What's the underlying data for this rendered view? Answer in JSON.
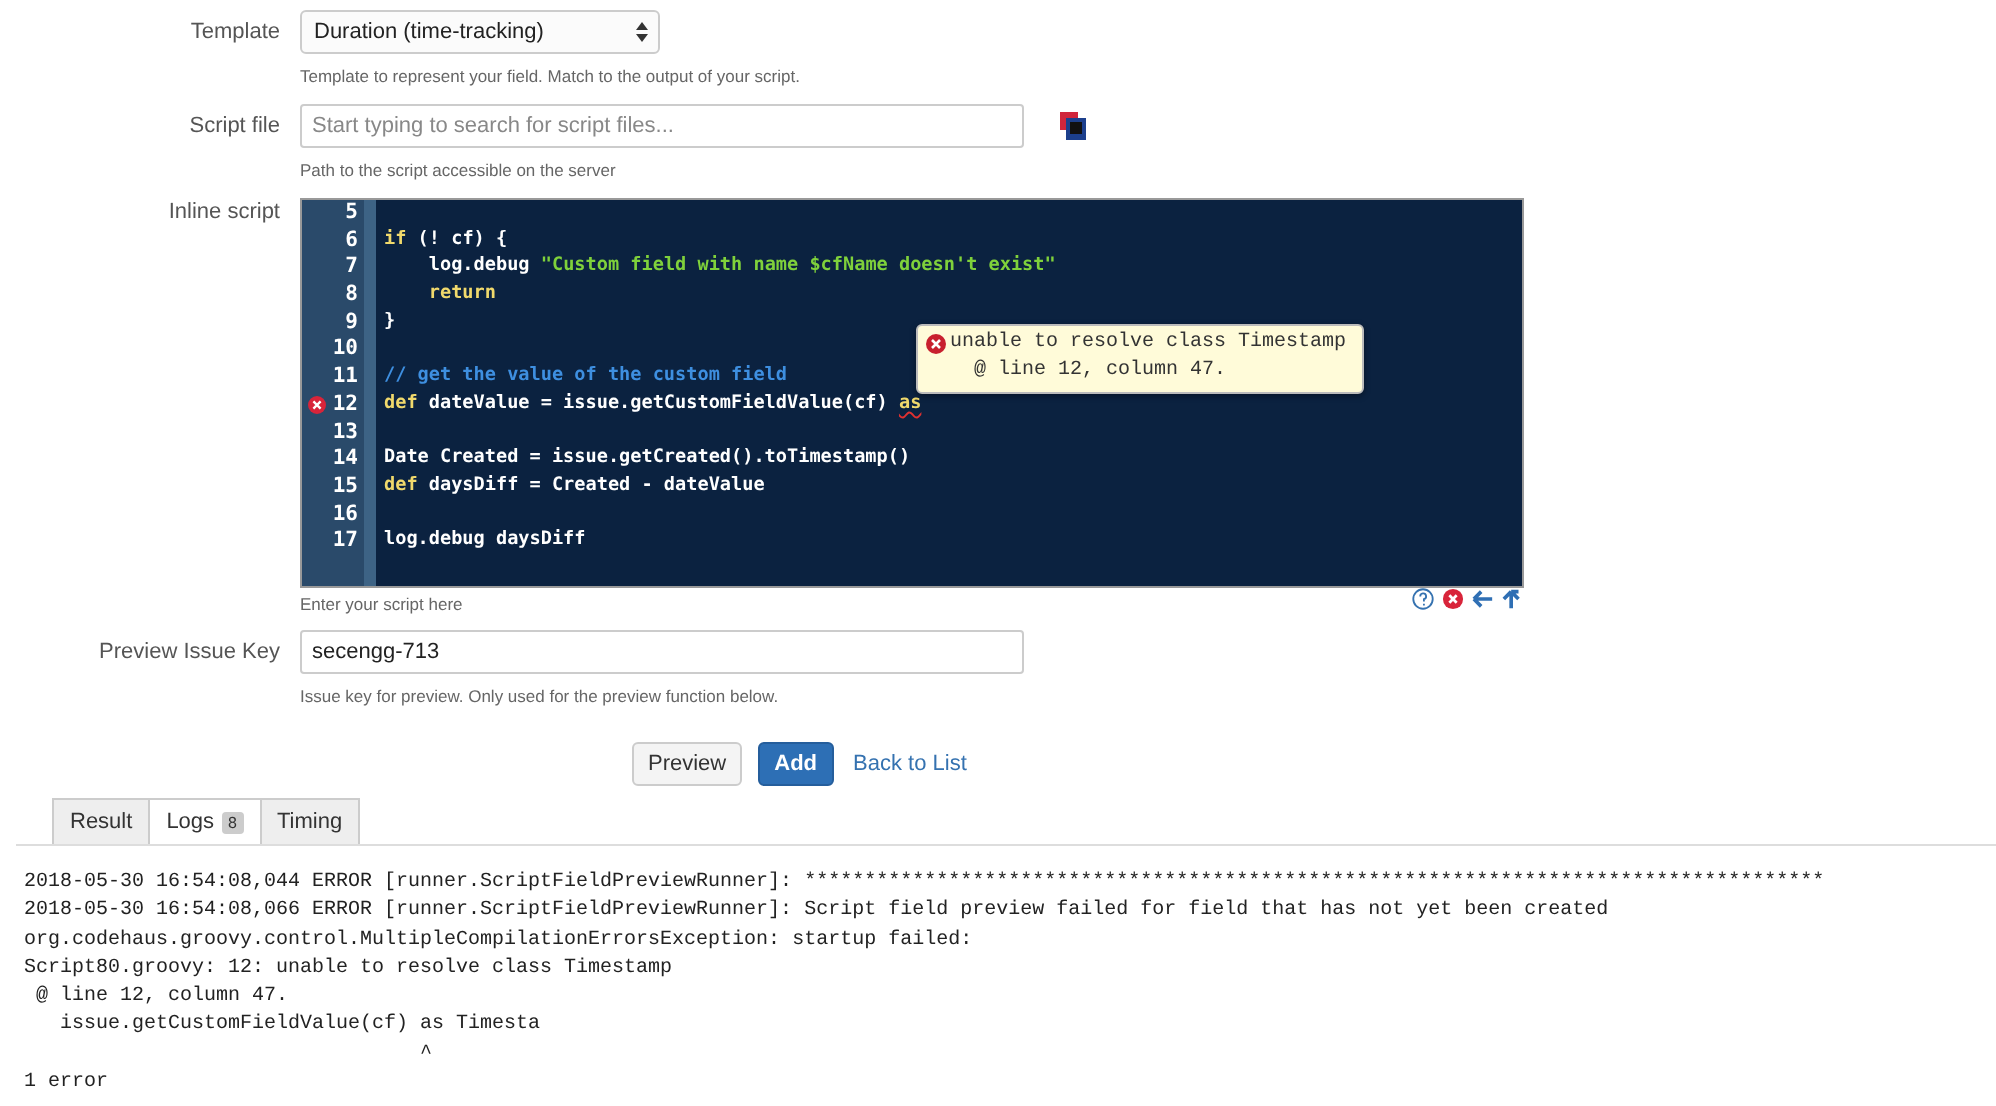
{
  "template": {
    "label": "Template",
    "value": "Duration (time-tracking)",
    "help": "Template to represent your field. Match to the output of your script."
  },
  "script_file": {
    "label": "Script file",
    "placeholder": "Start typing to search for script files...",
    "help": "Path to the script accessible on the server"
  },
  "inline_script": {
    "label": "Inline script",
    "help": "Enter your script here",
    "lines": [
      {
        "number": "5",
        "error": false
      },
      {
        "number": "6",
        "error": false,
        "tokens": [
          {
            "kind": "keyword",
            "text": "if"
          },
          {
            "kind": "plain",
            "text": " (! cf) {"
          }
        ]
      },
      {
        "number": "7",
        "error": false,
        "tokens": [
          {
            "kind": "plain",
            "text": "    log.debug "
          },
          {
            "kind": "string",
            "text": "\"Custom field with name $cfName doesn't exist\""
          }
        ]
      },
      {
        "number": "8",
        "error": false,
        "tokens": [
          {
            "kind": "keyword",
            "text": "    return"
          }
        ]
      },
      {
        "number": "9",
        "error": false,
        "tokens": [
          {
            "kind": "plain",
            "text": "}"
          }
        ]
      },
      {
        "number": "10",
        "error": false
      },
      {
        "number": "11",
        "error": false,
        "tokens": [
          {
            "kind": "comment",
            "text": "// get the value of the custom field"
          }
        ]
      },
      {
        "number": "12",
        "error": true,
        "tokens": [
          {
            "kind": "keyword",
            "text": "def"
          },
          {
            "kind": "plain",
            "text": " dateValue = issue.getCustomFieldValue(cf) "
          },
          {
            "kind": "faulty",
            "text": "as"
          }
        ]
      },
      {
        "number": "13",
        "error": false
      },
      {
        "number": "14",
        "error": false,
        "tokens": [
          {
            "kind": "plain",
            "text": "Date Created = issue.getCreated().toTimestamp()"
          }
        ]
      },
      {
        "number": "15",
        "error": false,
        "tokens": [
          {
            "kind": "keyword",
            "text": "def"
          },
          {
            "kind": "plain",
            "text": " daysDiff = Created - dateValue"
          }
        ]
      },
      {
        "number": "16",
        "error": false
      },
      {
        "number": "17",
        "error": false,
        "tokens": [
          {
            "kind": "plain",
            "text": "log.debug daysDiff"
          }
        ]
      }
    ],
    "tooltip": [
      "unable to resolve class Timestamp",
      "  @ line 12, column 47."
    ]
  },
  "preview_issue_key": {
    "label": "Preview Issue Key",
    "value": "secengg-713",
    "help": "Issue key for preview. Only used for the preview function below."
  },
  "buttons": [
    {
      "kind": "default",
      "label": "Preview"
    },
    {
      "kind": "primary",
      "label": "Add"
    },
    {
      "kind": "link",
      "label": "Back to List"
    }
  ],
  "tabs": [
    {
      "label": "Result",
      "selected": false
    },
    {
      "label": "Logs",
      "badge": "8",
      "selected": true
    },
    {
      "label": "Timing",
      "selected": false
    }
  ],
  "log_lines": [
    "2018-05-30 16:54:08,044 ERROR [runner.ScriptFieldPreviewRunner]: *************************************************************************************",
    "2018-05-30 16:54:08,066 ERROR [runner.ScriptFieldPreviewRunner]: Script field preview failed for field that has not yet been created",
    "org.codehaus.groovy.control.MultipleCompilationErrorsException: startup failed:",
    "Script80.groovy: 12: unable to resolve class Timestamp",
    " @ line 12, column 47.",
    "   issue.getCustomFieldValue(cf) as Timesta",
    "                                 ^",
    "1 error"
  ]
}
